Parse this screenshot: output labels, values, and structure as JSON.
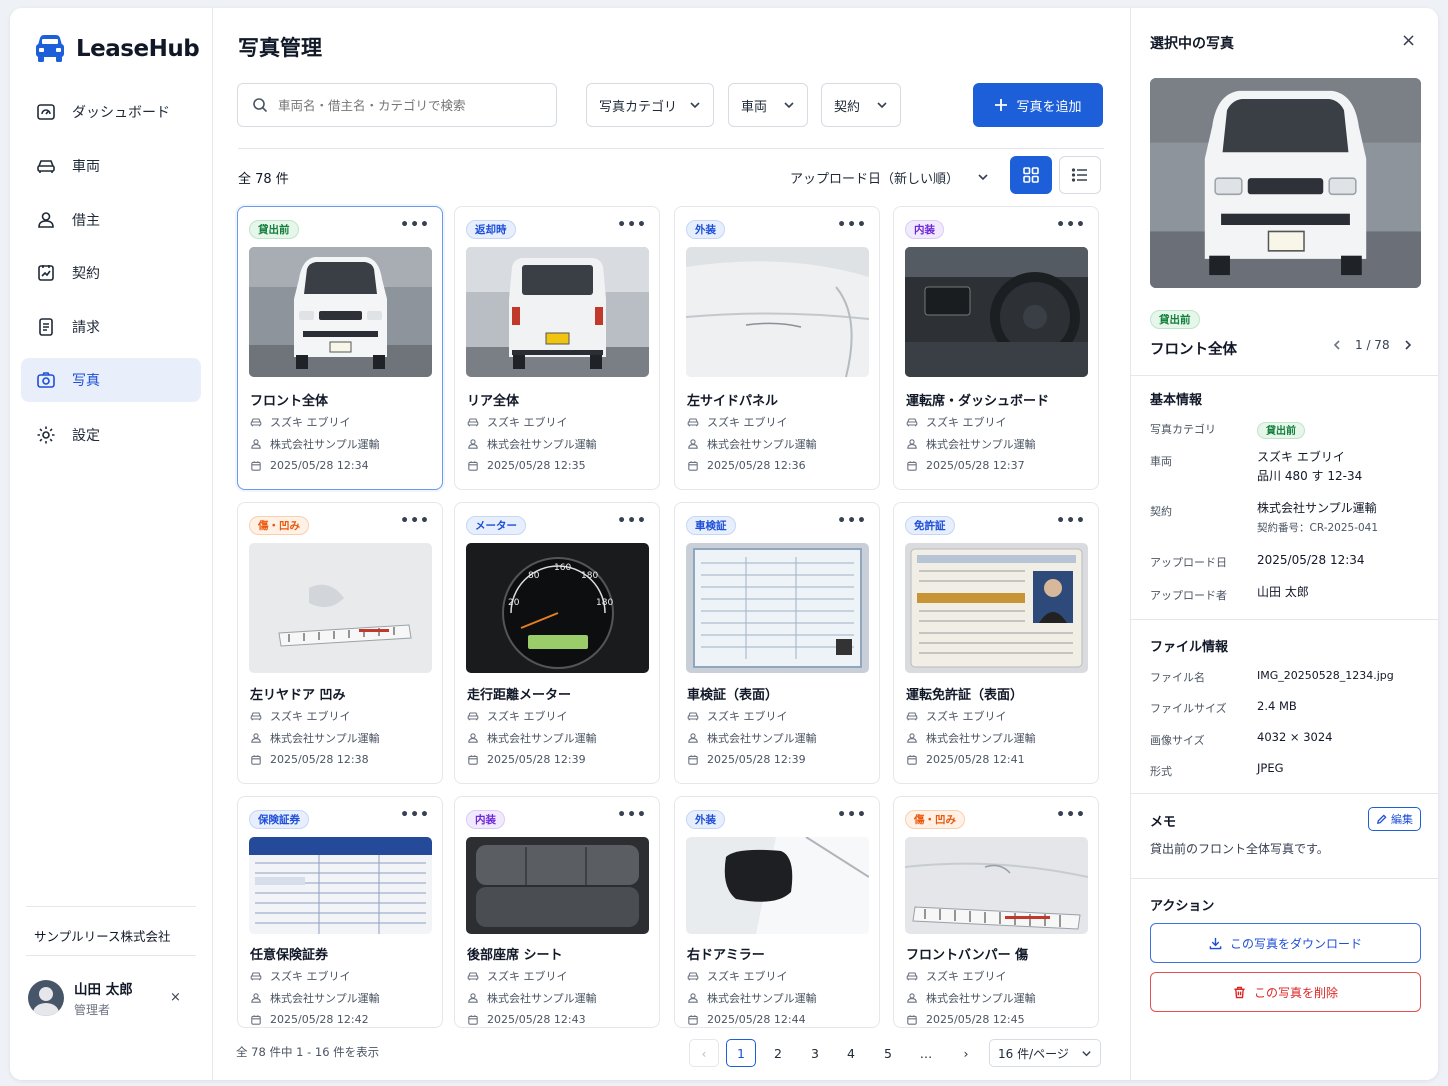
{
  "app": {
    "name": "LeaseHub"
  },
  "sidebar": {
    "items": [
      {
        "label": "ダッシュボード",
        "icon": "dashboard-icon"
      },
      {
        "label": "車両",
        "icon": "car-icon"
      },
      {
        "label": "借主",
        "icon": "user-icon"
      },
      {
        "label": "契約",
        "icon": "contract-icon"
      },
      {
        "label": "請求",
        "icon": "invoice-icon"
      },
      {
        "label": "写真",
        "icon": "camera-icon",
        "active": true
      },
      {
        "label": "設定",
        "icon": "gear-icon"
      }
    ],
    "company": "サンプルリース株式会社",
    "user": {
      "name": "山田 太郎",
      "role": "管理者",
      "close": "×"
    }
  },
  "main": {
    "title": "写真管理",
    "search_placeholder": "車両名・借主名・カテゴリで検索",
    "filters": [
      "写真カテゴリ",
      "車両",
      "契約"
    ],
    "add_button": "写真を追加",
    "total": "全 78 件",
    "sort_label": "アップロード日（新しい順）"
  },
  "cards": [
    {
      "badge": "貸出前",
      "badge_color": "green",
      "title": "フロント全体",
      "vehicle": "スズキ エブリイ",
      "lessee": "株式会社サンプル運輸",
      "date": "2025/05/28 12:34",
      "thumb": "van-front",
      "selected": true
    },
    {
      "badge": "返却時",
      "badge_color": "blue",
      "title": "リア全体",
      "vehicle": "スズキ エブリイ",
      "lessee": "株式会社サンプル運輸",
      "date": "2025/05/28 12:35",
      "thumb": "van-rear"
    },
    {
      "badge": "外装",
      "badge_color": "blue",
      "title": "左サイドパネル",
      "vehicle": "スズキ エブリイ",
      "lessee": "株式会社サンプル運輸",
      "date": "2025/05/28 12:36",
      "thumb": "side-panel"
    },
    {
      "badge": "内装",
      "badge_color": "purple",
      "title": "運転席・ダッシュボード",
      "vehicle": "スズキ エブリイ",
      "lessee": "株式会社サンプル運輸",
      "date": "2025/05/28 12:37",
      "thumb": "dashboard"
    },
    {
      "badge": "傷・凹み",
      "badge_color": "orange",
      "title": "左リヤドア 凹み",
      "vehicle": "スズキ エブリイ",
      "lessee": "株式会社サンプル運輸",
      "date": "2025/05/28 12:38",
      "thumb": "dent"
    },
    {
      "badge": "メーター",
      "badge_color": "blue",
      "title": "走行距離メーター",
      "vehicle": "スズキ エブリイ",
      "lessee": "株式会社サンプル運輸",
      "date": "2025/05/28 12:39",
      "thumb": "meter"
    },
    {
      "badge": "車検証",
      "badge_color": "blue",
      "title": "車検証（表面）",
      "vehicle": "スズキ エブリイ",
      "lessee": "株式会社サンプル運輸",
      "date": "2025/05/28 12:39",
      "thumb": "document"
    },
    {
      "badge": "免許証",
      "badge_color": "blue",
      "title": "運転免許証（表面）",
      "vehicle": "スズキ エブリイ",
      "lessee": "株式会社サンプル運輸",
      "date": "2025/05/28 12:41",
      "thumb": "license"
    },
    {
      "badge": "保険証券",
      "badge_color": "blue",
      "title": "任意保険証券",
      "vehicle": "スズキ エブリイ",
      "lessee": "株式会社サンプル運輸",
      "date": "2025/05/28 12:42",
      "thumb": "insurance"
    },
    {
      "badge": "内装",
      "badge_color": "purple",
      "title": "後部座席 シート",
      "vehicle": "スズキ エブリイ",
      "lessee": "株式会社サンプル運輸",
      "date": "2025/05/28 12:43",
      "thumb": "seat"
    },
    {
      "badge": "外装",
      "badge_color": "blue",
      "title": "右ドアミラー",
      "vehicle": "スズキ エブリイ",
      "lessee": "株式会社サンプル運輸",
      "date": "2025/05/28 12:44",
      "thumb": "mirror"
    },
    {
      "badge": "傷・凹み",
      "badge_color": "orange",
      "title": "フロントバンパー 傷",
      "vehicle": "スズキ エブリイ",
      "lessee": "株式会社サンプル運輸",
      "date": "2025/05/28 12:45",
      "thumb": "bumper"
    }
  ],
  "pagination": {
    "info": "全 78 件中 1 - 16 件を表示",
    "pages": [
      "1",
      "2",
      "3",
      "4",
      "5",
      "…"
    ],
    "current": "1",
    "per_page": "16 件/ページ"
  },
  "panel": {
    "title": "選択中の写真",
    "close": "×",
    "badge": "貸出前",
    "name": "フロント全体",
    "position": "1 / 78",
    "basic_title": "基本情報",
    "basic": [
      {
        "key": "写真カテゴリ",
        "value": "貸出前"
      },
      {
        "key": "車両",
        "value": "スズキ エブリイ",
        "sub": "品川 480 す 12-34"
      },
      {
        "key": "契約",
        "value": "株式会社サンプル運輸",
        "sub": "契約番号：CR-2025-041"
      },
      {
        "key": "アップロード日",
        "value": "2025/05/28 12:34"
      },
      {
        "key": "アップロード者",
        "value": "山田 太郎"
      }
    ],
    "file_title": "ファイル情報",
    "file": [
      {
        "key": "ファイル名",
        "value": "IMG_20250528_1234.jpg"
      },
      {
        "key": "ファイルサイズ",
        "value": "2.4 MB"
      },
      {
        "key": "画像サイズ",
        "value": "4032 × 3024"
      },
      {
        "key": "形式",
        "value": "JPEG"
      }
    ],
    "memo_title": "メモ",
    "edit_label": "編集",
    "memo": "貸出前のフロント全体写真です。",
    "actions_title": "アクション",
    "download_label": "この写真をダウンロード",
    "delete_label": "この写真を削除"
  },
  "colors": {
    "accent": "#1d5fd8",
    "danger": "#dc2626",
    "success": "#15803d"
  }
}
